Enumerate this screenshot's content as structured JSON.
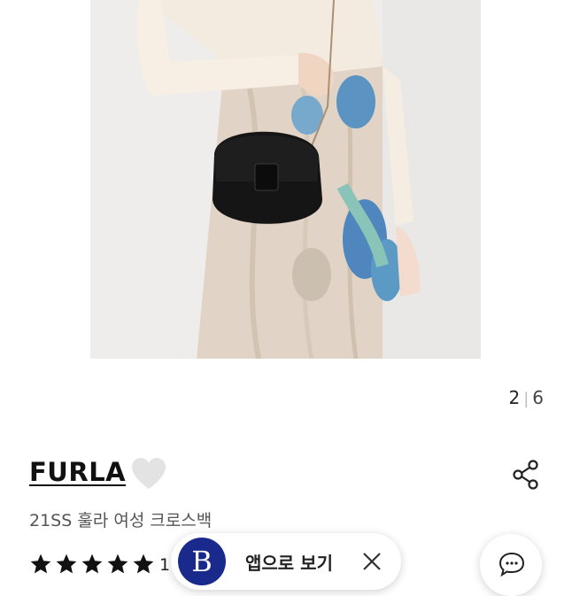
{
  "gallery": {
    "image_description_alt": "",
    "current_page": "2",
    "separator": "|",
    "total_pages": "6"
  },
  "product": {
    "brand": "FURLA",
    "name": "21SS 훌라 여성 크로스백",
    "rating_stars": 5,
    "rating_count": "1"
  },
  "app_banner": {
    "logo_letter": "B",
    "label": "앱으로 보기"
  },
  "icons": {
    "wishlist": "heart-icon",
    "share": "share-icon",
    "close": "close-icon",
    "chat": "chat-bubble-icon",
    "star": "star-icon"
  },
  "colors": {
    "brand_navy": "#1a2a8c",
    "heart_gray": "#e3e3e3",
    "star_black": "#111111"
  }
}
